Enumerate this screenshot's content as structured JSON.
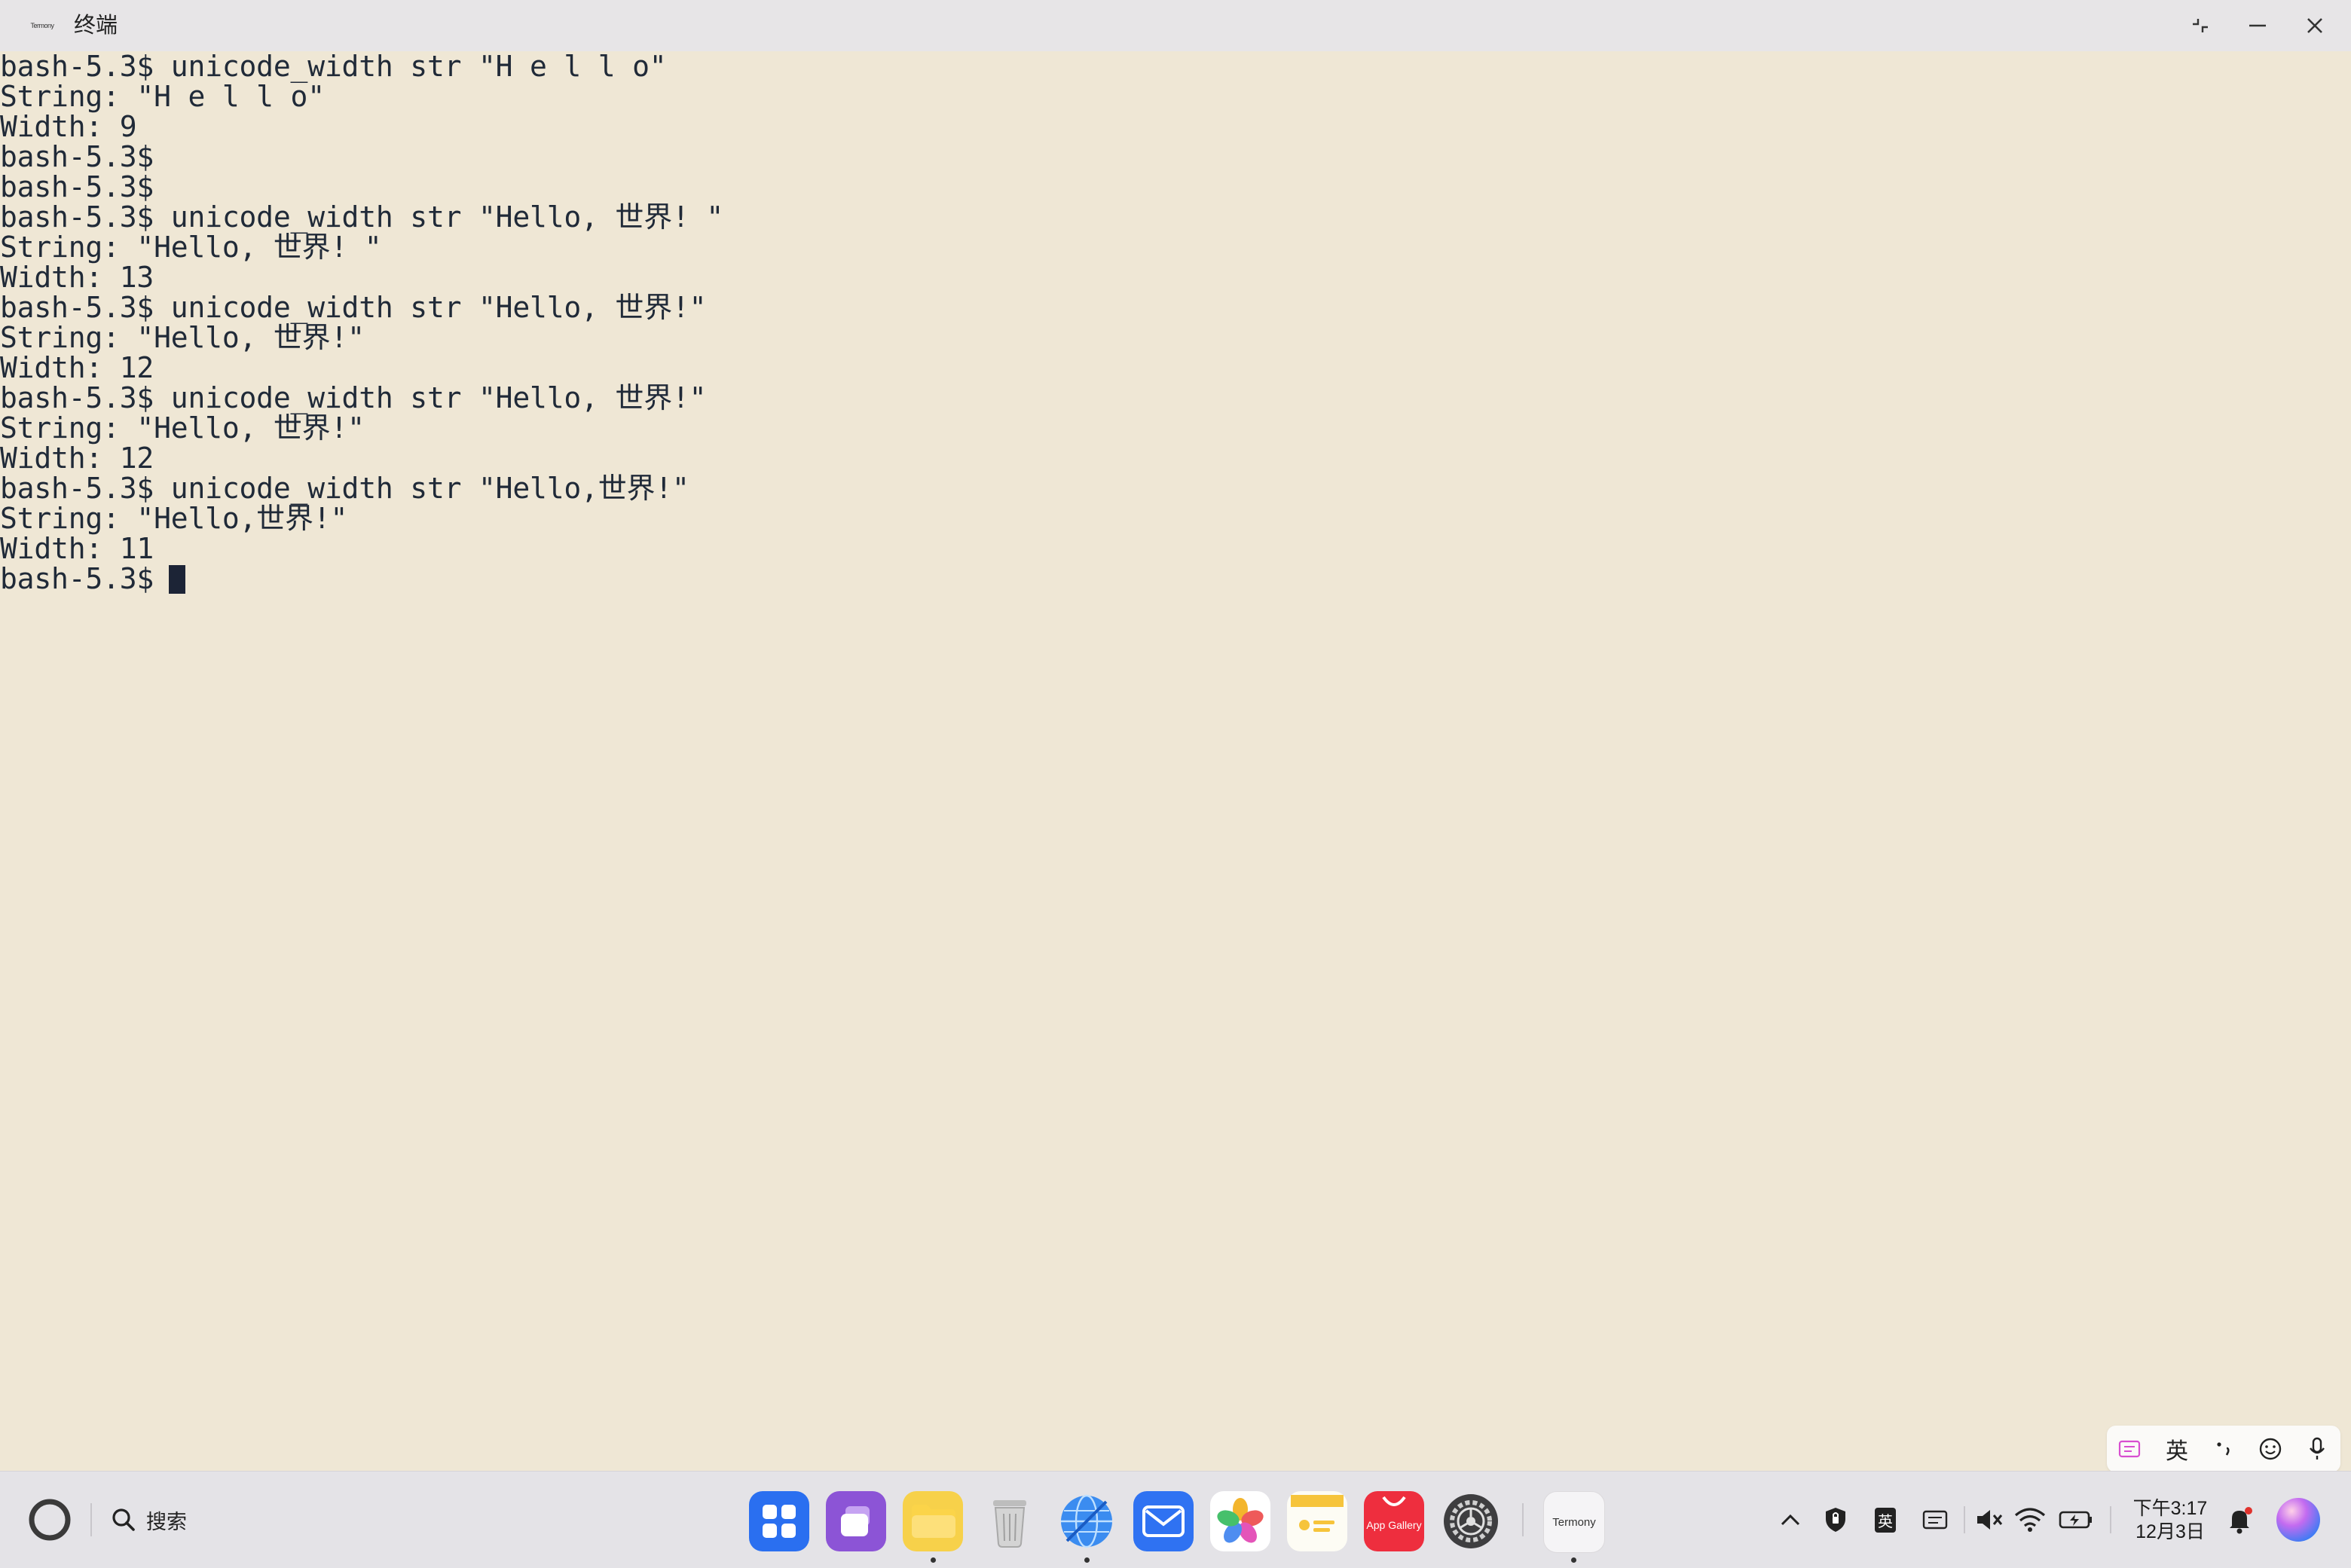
{
  "window": {
    "title": "终端",
    "app_icon_label": "Termony"
  },
  "terminal": {
    "lines": [
      "bash-5.3$ unicode_width str \"H e l l o\"",
      "String: \"H e l l o\"",
      "Width: 9",
      "bash-5.3$",
      "bash-5.3$",
      "bash-5.3$ unicode_width str \"Hello, 世界! \"",
      "String: \"Hello, 世界! \"",
      "Width: 13",
      "bash-5.3$ unicode_width str \"Hello, 世界!\"",
      "String: \"Hello, 世界!\"",
      "Width: 12",
      "bash-5.3$ unicode_width str \"Hello, 世界!\"",
      "String: \"Hello, 世界!\"",
      "Width: 12",
      "bash-5.3$ unicode_width str \"Hello,世界!\"",
      "String: \"Hello,世界!\"",
      "Width: 11"
    ],
    "prompt": "bash-5.3$",
    "background_color": "#efe7d5",
    "text_color": "#202a38"
  },
  "ime": {
    "mode_label": "英",
    "icons": [
      "keyboard-icon",
      "lang-toggle",
      "punctuation-icon",
      "emoji-icon",
      "mic-icon"
    ]
  },
  "taskbar": {
    "search_label": "搜索",
    "dock_apps": [
      {
        "name": "app-center",
        "icon": "grid-icon",
        "running": false
      },
      {
        "name": "multitask",
        "icon": "multitask-icon",
        "running": false
      },
      {
        "name": "files",
        "icon": "folder-icon",
        "running": true
      },
      {
        "name": "trash",
        "icon": "trash-icon",
        "running": false
      },
      {
        "name": "browser",
        "icon": "globe-icon",
        "running": true
      },
      {
        "name": "mail",
        "icon": "mail-icon",
        "running": false
      },
      {
        "name": "photos",
        "icon": "flower-icon",
        "running": false
      },
      {
        "name": "notes",
        "icon": "notes-icon",
        "running": false
      },
      {
        "name": "app-gallery",
        "icon": "appgallery-icon",
        "label": "App Gallery",
        "running": false
      },
      {
        "name": "settings",
        "icon": "gear-icon",
        "running": false
      },
      {
        "name": "termony",
        "icon": "termony-icon",
        "label": "Termony",
        "running": true
      }
    ],
    "tray_ime_label": "英",
    "clock_time": "下午3:17",
    "clock_date": "12月3日"
  }
}
